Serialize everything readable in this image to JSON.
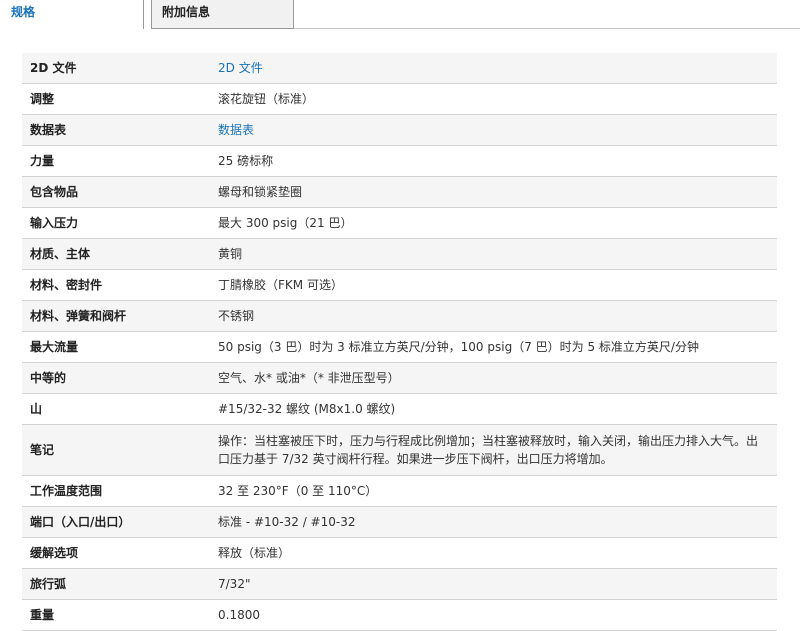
{
  "tabs": {
    "active_label": "规格",
    "inactive_label": "附加信息"
  },
  "specs": [
    {
      "label": "2D 文件",
      "value": "2D 文件",
      "is_link": true
    },
    {
      "label": "调整",
      "value": "滚花旋钮（标准）",
      "is_link": false
    },
    {
      "label": "数据表",
      "value": "数据表",
      "is_link": true
    },
    {
      "label": "力量",
      "value": "25 磅标称",
      "is_link": false
    },
    {
      "label": "包含物品",
      "value": "螺母和锁紧垫圈",
      "is_link": false
    },
    {
      "label": "输入压力",
      "value": "最大 300 psig（21 巴）",
      "is_link": false
    },
    {
      "label": "材质、主体",
      "value": "黄铜",
      "is_link": false
    },
    {
      "label": "材料、密封件",
      "value": "丁腈橡胶（FKM 可选）",
      "is_link": false
    },
    {
      "label": "材料、弹簧和阀杆",
      "value": "不锈钢",
      "is_link": false
    },
    {
      "label": "最大流量",
      "value": "50 psig（3 巴）时为 3 标准立方英尺/分钟，100 psig（7 巴）时为 5 标准立方英尺/分钟",
      "is_link": false
    },
    {
      "label": "中等的",
      "value": "空气、水* 或油*（* 非泄压型号）",
      "is_link": false
    },
    {
      "label": "山",
      "value": "#15/32-32 螺纹 (M8x1.0 螺纹)",
      "is_link": false
    },
    {
      "label": "笔记",
      "value": "操作：当柱塞被压下时，压力与行程成比例增加；当柱塞被释放时，输入关闭，输出压力排入大气。出口压力基于 7/32 英寸阀杆行程。如果进一步压下阀杆，出口压力将增加。",
      "is_link": false
    },
    {
      "label": "工作温度范围",
      "value": "32 至 230°F（0 至 110°C）",
      "is_link": false
    },
    {
      "label": "端口（入口/出口）",
      "value": "标准 - #10-32 / #10-32",
      "is_link": false
    },
    {
      "label": "缓解选项",
      "value": "释放（标准）",
      "is_link": false
    },
    {
      "label": "旅行弧",
      "value": "7/32\"",
      "is_link": false
    },
    {
      "label": "重量",
      "value": "0.1800",
      "is_link": false
    }
  ]
}
